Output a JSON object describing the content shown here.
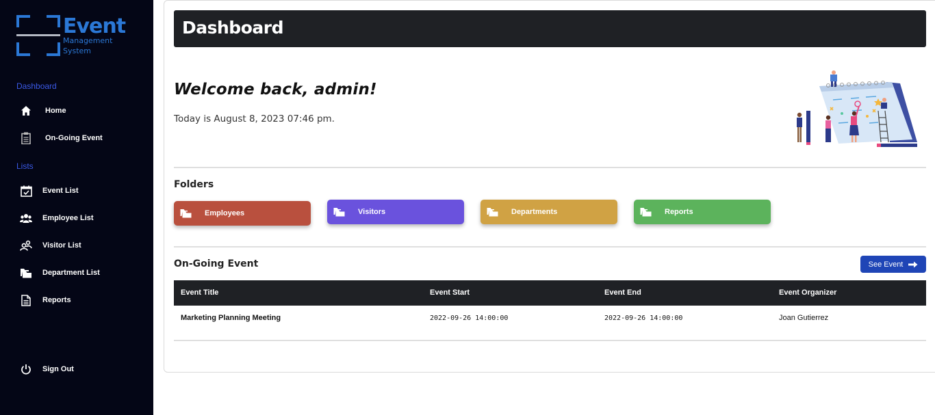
{
  "logo": {
    "brand": "Event",
    "sub_line1": "Management",
    "sub_line2": "System"
  },
  "sidebar": {
    "section_dashboard": "Dashboard",
    "section_lists": "Lists",
    "items": [
      {
        "label": "Home",
        "icon": "home-icon"
      },
      {
        "label": "On-Going Event",
        "icon": "clipboard-icon"
      },
      {
        "label": "Event List",
        "icon": "calendar-check-icon"
      },
      {
        "label": "Employee List",
        "icon": "users-icon"
      },
      {
        "label": "Visitor List",
        "icon": "user-group-icon"
      },
      {
        "label": "Department List",
        "icon": "folders-icon"
      },
      {
        "label": "Reports",
        "icon": "document-icon"
      }
    ],
    "sign_out": "Sign Out"
  },
  "header": {
    "title": "Dashboard"
  },
  "welcome": {
    "greeting": "Welcome back, admin!",
    "today": "Today is August 8, 2023 07:46 pm."
  },
  "folders": {
    "title": "Folders",
    "items": [
      {
        "label": "Employees",
        "color": "#b9503e"
      },
      {
        "label": "Visitors",
        "color": "#6a52dd"
      },
      {
        "label": "Departments",
        "color": "#d0a244"
      },
      {
        "label": "Reports",
        "color": "#5cb35c"
      }
    ]
  },
  "ongoing": {
    "title": "On-Going Event",
    "see_event_label": "See Event",
    "columns": [
      "Event Title",
      "Event Start",
      "Event End",
      "Event Organizer"
    ],
    "rows": [
      [
        "Marketing Planning Meeting",
        "2022-09-26 14:00:00",
        "2022-09-26 14:00:00",
        "Joan Gutierrez"
      ]
    ]
  }
}
